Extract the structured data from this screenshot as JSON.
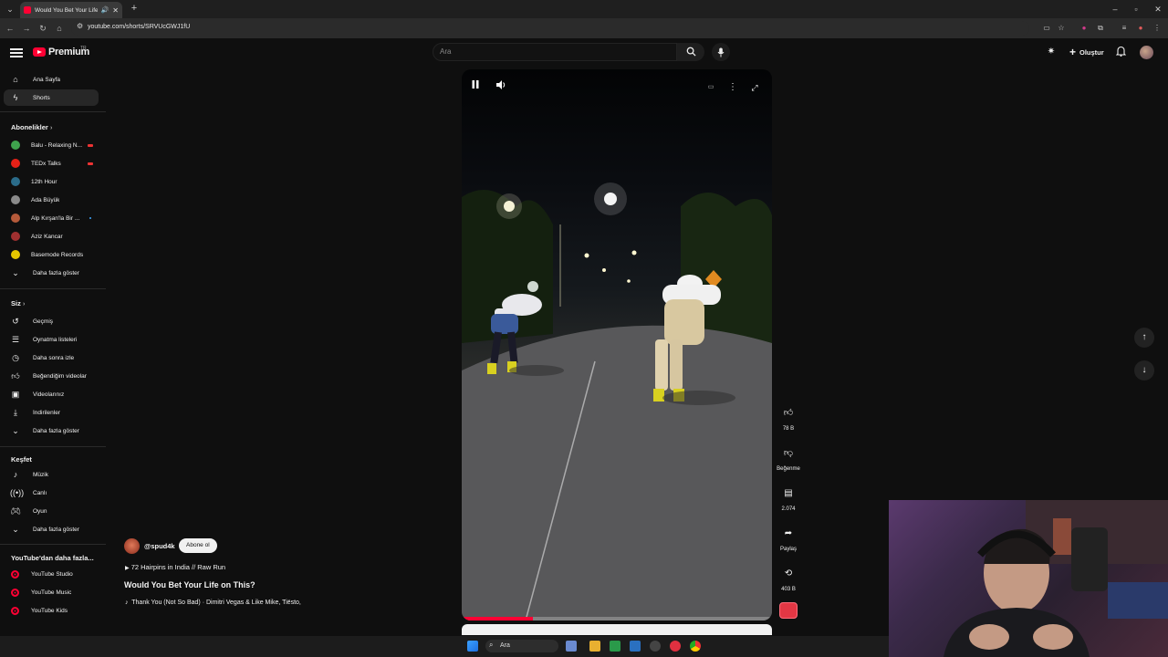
{
  "browser": {
    "tab_title": "Would You Bet Your Life on",
    "url": "youtube.com/shorts/SRVUcGWJ1fU"
  },
  "header": {
    "logo_text": "Premium",
    "logo_region": "TR",
    "search_placeholder": "Ara",
    "create_label": "Oluştur"
  },
  "sidebar": {
    "main": [
      {
        "label": "Ana Sayfa",
        "icon": "home-icon"
      },
      {
        "label": "Shorts",
        "icon": "shorts-icon",
        "active": true
      }
    ],
    "subs_title": "Abonelikler",
    "subs": [
      {
        "label": "Balu - Relaxing N...",
        "color": "#3fa34d",
        "live": true
      },
      {
        "label": "TEDx Talks",
        "color": "#e62117",
        "live": true
      },
      {
        "label": "12th Hour",
        "color": "#2b6c8a"
      },
      {
        "label": "Ada Büyük",
        "color": "#8a8a8a"
      },
      {
        "label": "Alp Kırşan'la Bir ...",
        "color": "#b55a3a",
        "new": true
      },
      {
        "label": "Aziz Kancar",
        "color": "#a03030"
      },
      {
        "label": "Basemode Records",
        "color": "#e6c700"
      }
    ],
    "subs_more": "Daha fazla göster",
    "you_title": "Siz",
    "you": [
      {
        "label": "Geçmiş",
        "icon": "history-icon"
      },
      {
        "label": "Oynatma listeleri",
        "icon": "playlists-icon"
      },
      {
        "label": "Daha sonra izle",
        "icon": "watch-later-icon"
      },
      {
        "label": "Beğendiğim videolar",
        "icon": "liked-videos-icon"
      },
      {
        "label": "Videolarınız",
        "icon": "your-videos-icon"
      },
      {
        "label": "İndirilenler",
        "icon": "downloads-icon"
      }
    ],
    "you_more": "Daha fazla göster",
    "explore_title": "Keşfet",
    "explore": [
      {
        "label": "Müzik",
        "icon": "music-icon"
      },
      {
        "label": "Canlı",
        "icon": "live-icon"
      },
      {
        "label": "Oyun",
        "icon": "gaming-icon"
      }
    ],
    "explore_more": "Daha fazla göster",
    "more_title": "YouTube'dan daha fazla...",
    "more": [
      {
        "label": "YouTube Studio"
      },
      {
        "label": "YouTube Music"
      },
      {
        "label": "YouTube Kids"
      }
    ]
  },
  "player": {
    "progress": 0.23
  },
  "actions": {
    "likes": "78 B",
    "dislike": "Beğenme",
    "comments": "2.074",
    "share": "Paylaş",
    "remix": "403 B"
  },
  "video": {
    "channel": "@spud4k",
    "subscribe": "Abone ol",
    "playlist": "72 Hairpins in India // Raw Run",
    "title": "Would You Bet Your Life on This?",
    "music": "Thank You (Not So Bad) · Dimitri Vegas & Like Mike, Tiësto,"
  },
  "taskbar": {
    "search_label": "Ara"
  }
}
